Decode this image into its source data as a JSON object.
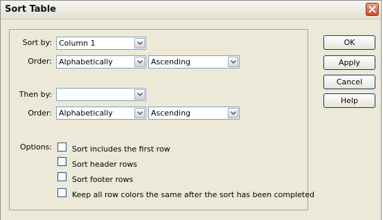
{
  "window": {
    "title": "Sort Table"
  },
  "sort_by": {
    "label": "Sort by:",
    "value": "Column 1"
  },
  "order1": {
    "label": "Order:",
    "type": "Alphabetically",
    "direction": "Ascending"
  },
  "then_by": {
    "label": "Then by:",
    "value": ""
  },
  "order2": {
    "label": "Order:",
    "type": "Alphabetically",
    "direction": "Ascending"
  },
  "options": {
    "label": "Options:",
    "items": [
      {
        "label": "Sort includes the first row",
        "checked": false
      },
      {
        "label": "Sort header rows",
        "checked": false
      },
      {
        "label": "Sort footer rows",
        "checked": false
      },
      {
        "label": "Keep all row colors the same after the sort has been completed",
        "checked": false
      }
    ]
  },
  "buttons": {
    "ok": "OK",
    "apply": "Apply",
    "cancel": "Cancel",
    "help": "Help"
  },
  "icons": {
    "close": "close-icon",
    "dropdown": "chevron-down-icon"
  },
  "colors": {
    "close_button": "#c6502c",
    "button_border": "#003c74",
    "field_border": "#7f9db9"
  }
}
